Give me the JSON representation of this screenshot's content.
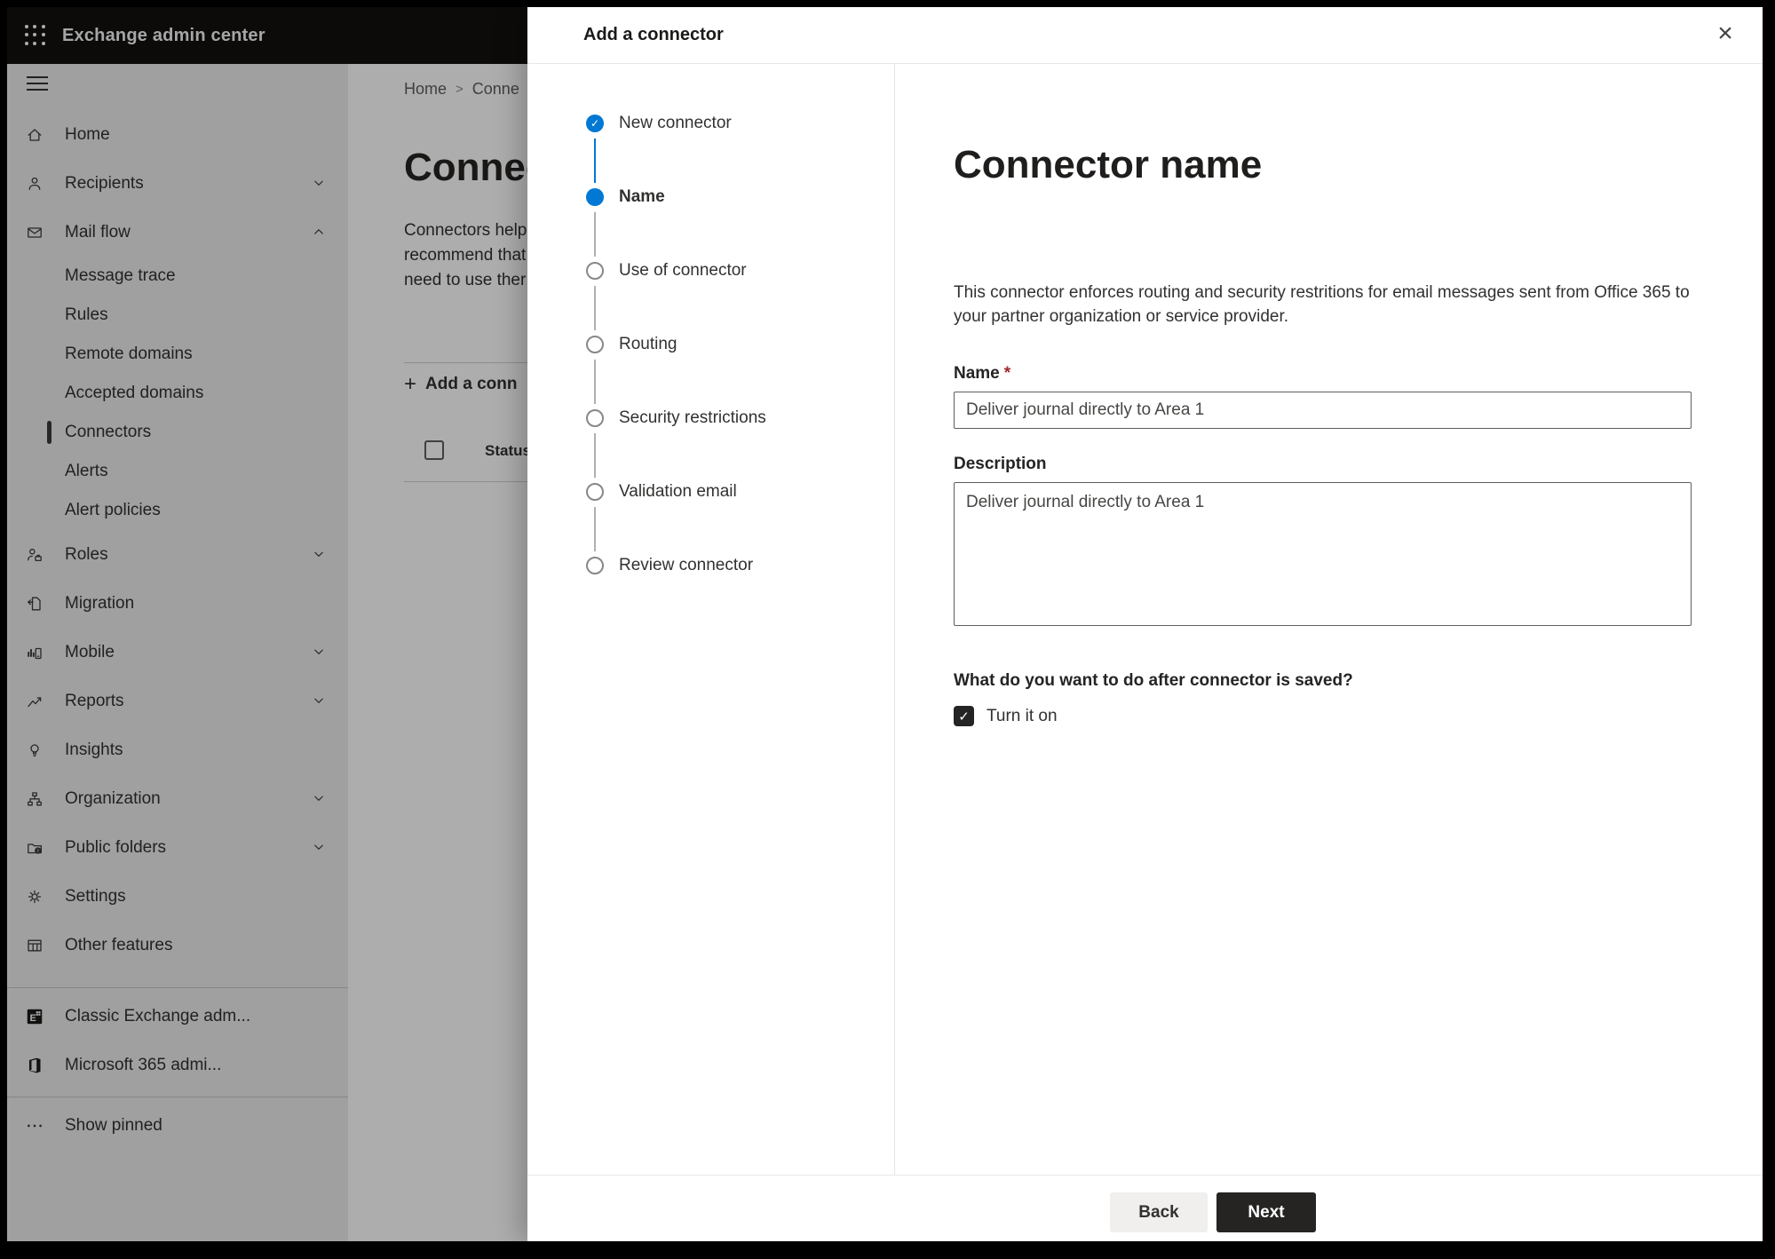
{
  "app": {
    "title": "Exchange admin center"
  },
  "breadcrumb": {
    "home": "Home",
    "separator": ">",
    "current": "Conne"
  },
  "page": {
    "heading": "Connec",
    "description_lines": [
      "Connectors help",
      "recommend that",
      "need to use ther"
    ],
    "add_icon": "+",
    "add_button": "Add a conn",
    "status_header": "Status"
  },
  "sidebar": {
    "items": [
      {
        "label": "Home",
        "icon": "home",
        "level": 0
      },
      {
        "label": "Recipients",
        "icon": "person",
        "level": 0,
        "chevron": "down"
      },
      {
        "label": "Mail flow",
        "icon": "mail",
        "level": 0,
        "chevron": "up"
      },
      {
        "label": "Message trace",
        "level": 1
      },
      {
        "label": "Rules",
        "level": 1
      },
      {
        "label": "Remote domains",
        "level": 1
      },
      {
        "label": "Accepted domains",
        "level": 1
      },
      {
        "label": "Connectors",
        "level": 1,
        "selected": true
      },
      {
        "label": "Alerts",
        "level": 1
      },
      {
        "label": "Alert policies",
        "level": 1
      },
      {
        "label": "Roles",
        "icon": "roles",
        "level": 0,
        "chevron": "down"
      },
      {
        "label": "Migration",
        "icon": "migration",
        "level": 0
      },
      {
        "label": "Mobile",
        "icon": "mobile",
        "level": 0,
        "chevron": "down"
      },
      {
        "label": "Reports",
        "icon": "reports",
        "level": 0,
        "chevron": "down"
      },
      {
        "label": "Insights",
        "icon": "insights",
        "level": 0
      },
      {
        "label": "Organization",
        "icon": "org",
        "level": 0,
        "chevron": "down"
      },
      {
        "label": "Public folders",
        "icon": "folders",
        "level": 0,
        "chevron": "down"
      },
      {
        "label": "Settings",
        "icon": "gear",
        "level": 0
      },
      {
        "label": "Other features",
        "icon": "grid",
        "level": 0
      }
    ],
    "footer_items": [
      {
        "label": "Classic Exchange adm...",
        "icon": "exchange"
      },
      {
        "label": "Microsoft 365 admi...",
        "icon": "office"
      }
    ],
    "show_pinned": {
      "label": "Show pinned",
      "icon": "dots"
    }
  },
  "dialog": {
    "title": "Add a connector",
    "close_icon": "×",
    "steps": [
      {
        "label": "New connector",
        "state": "done"
      },
      {
        "label": "Name",
        "state": "current"
      },
      {
        "label": "Use of connector",
        "state": "todo"
      },
      {
        "label": "Routing",
        "state": "todo"
      },
      {
        "label": "Security restrictions",
        "state": "todo"
      },
      {
        "label": "Validation email",
        "state": "todo"
      },
      {
        "label": "Review connector",
        "state": "todo"
      }
    ],
    "content": {
      "heading": "Connector name",
      "description": "This connector enforces routing and security restritions for email messages sent from Office 365 to your partner organization or service provider.",
      "name_label": "Name",
      "required_marker": "*",
      "name_value": "Deliver journal directly to Area 1",
      "description_label": "Description",
      "description_value": "Deliver journal directly to Area 1",
      "after_save_question": "What do you want to do after connector is saved?",
      "turn_on_label": "Turn it on",
      "turn_on_checked": true
    },
    "footer": {
      "back": "Back",
      "next": "Next"
    }
  },
  "icons": {
    "check": "✓"
  },
  "colors": {
    "accent": "#0078d4",
    "required_marker": "#a4262c",
    "step_todo_border": "#8a8886",
    "selected_item_bar": "#3b3a39",
    "next_button_bg": "#252423",
    "back_button_bg": "#f0efee",
    "topbar_bg": "#121110"
  }
}
